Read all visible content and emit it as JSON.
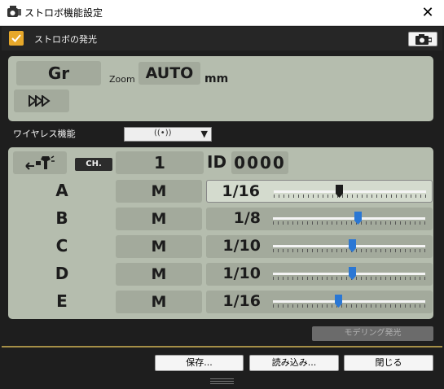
{
  "window": {
    "title": "ストロボ機能設定",
    "close_glyph": "✕"
  },
  "flash": {
    "enabled": true,
    "label": "ストロボの発光"
  },
  "top_panel": {
    "mode": "Gr",
    "zoom_label": "Zoom",
    "zoom_value": "AUTO",
    "unit": "mm"
  },
  "wireless": {
    "label": "ワイヤレス機能",
    "selected": "((•))",
    "dropdown_glyph": "▼"
  },
  "main_panel": {
    "ch_label": "CH.",
    "ch_value": "1",
    "id_label": "ID",
    "id_value": "0000",
    "groups": [
      {
        "letter": "A",
        "mode": "M",
        "power": "1/16",
        "selected": true,
        "level": 0.43,
        "thumb_color": "#1c1c1c"
      },
      {
        "letter": "B",
        "mode": "M",
        "power": "1/8",
        "selected": false,
        "level": 0.56,
        "thumb_color": "#2a77d4"
      },
      {
        "letter": "C",
        "mode": "M",
        "power": "1/10",
        "selected": false,
        "level": 0.52,
        "thumb_color": "#2a77d4"
      },
      {
        "letter": "D",
        "mode": "M",
        "power": "1/10",
        "selected": false,
        "level": 0.52,
        "thumb_color": "#2a77d4"
      },
      {
        "letter": "E",
        "mode": "M",
        "power": "1/16",
        "selected": false,
        "level": 0.43,
        "thumb_color": "#2a77d4"
      }
    ]
  },
  "modeling_button": "モデリング発光",
  "footer": {
    "save": "保存...",
    "load": "読み込み...",
    "close": "閉じる"
  },
  "colors": {
    "lcd_background": "#b5bdae",
    "cell_background": "#a3aa9c",
    "checkbox": "#e7a82a",
    "accent_line": "#a58f47",
    "slider_thumb": "#2a77d4"
  }
}
